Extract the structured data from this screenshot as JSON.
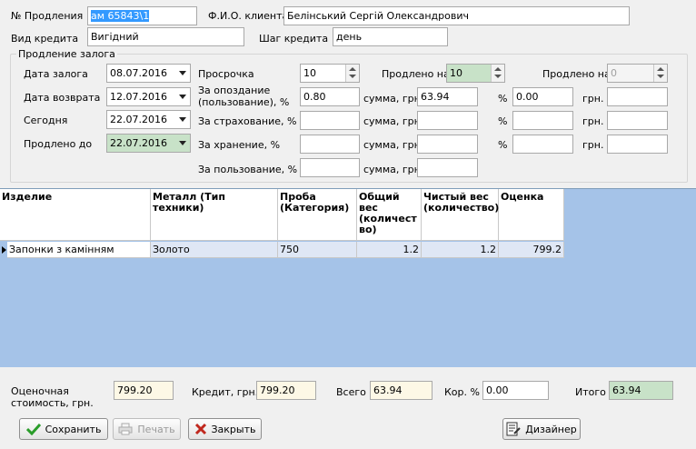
{
  "header": {
    "prolong_no_label": "№ Продления",
    "prolong_no_value": "ам 65843\\1",
    "client_label": "Ф.И.О. клиента",
    "client_value": "Белінський Сергій Олександрович",
    "credit_type_label": "Вид кредита",
    "credit_type_value": "Вигідний",
    "credit_step_label": "Шаг кредита",
    "credit_step_value": "день"
  },
  "prolong": {
    "group_title": "Продление залога",
    "pledge_date_label": "Дата залога",
    "pledge_date_value": "08.07.2016",
    "return_date_label": "Дата возврата",
    "return_date_value": "12.07.2016",
    "today_label": "Сегодня",
    "today_value": "22.07.2016",
    "extended_to_label": "Продлено до",
    "extended_to_value": "22.07.2016",
    "overdue_label": "Просрочка",
    "overdue_value": "10",
    "extended_by_label": "Продлено на",
    "extended_by_value": "10",
    "extended_by2_label": "Продлено на",
    "extended_by2_value": "0",
    "late_label": "За опоздание\n(пользование), %",
    "late_pct": "0.80",
    "insurance_label": "За страхование, %",
    "storage_label": "За хранение, %",
    "usage_label": "За пользование, %",
    "sum_label": "сумма, грн.",
    "late_sum": "63.94",
    "pct_label": "%",
    "late_pct2": "0.00",
    "uah_label": "грн."
  },
  "grid": {
    "columns": [
      "Изделие",
      "Металл (Тип техники)",
      "Проба\n(Категория)",
      "Общий\nвес\n(количест\nво)",
      "Чистый вес\n(количество)",
      "Оценка"
    ],
    "rows": [
      {
        "item": "Запонки з камінням",
        "metal": "Золото",
        "probe": "750",
        "total_weight": "1.2",
        "net_weight": "1.2",
        "estimate": "799.2"
      }
    ]
  },
  "footer": {
    "estimate_label": "Оценочная\nстоимость, грн.",
    "estimate_value": "799.20",
    "credit_label": "Кредит, грн.",
    "credit_value": "799.20",
    "total_label": "Всего",
    "total_value": "63.94",
    "corr_label": "Кор. %",
    "corr_value": "0.00",
    "result_label": "Итого",
    "result_value": "63.94"
  },
  "buttons": {
    "save": "Сохранить",
    "print": "Печать",
    "close": "Закрыть",
    "designer": "Дизайнер"
  },
  "colors": {
    "grid_background": "#a5c3e8",
    "selected_text_bg": "#3399ff",
    "green_field": "#c8e2c8",
    "yellow_field": "#fdf8e6"
  }
}
